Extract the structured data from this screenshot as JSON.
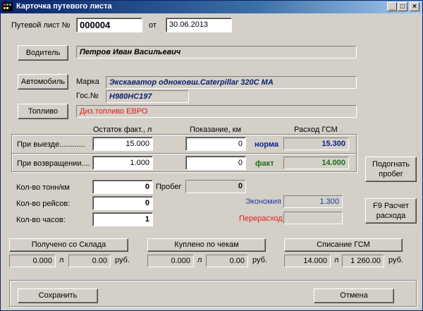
{
  "window": {
    "title": "Карточка путевого листа",
    "controls": [
      "_",
      "□",
      "×"
    ]
  },
  "header": {
    "waybill_label": "Путевой лист №",
    "waybill_number": "000004",
    "date_label": "от",
    "date_value": "30.06.2013"
  },
  "driver": {
    "button": "Водитель",
    "value": "Петров Иван Васильевич"
  },
  "vehicle": {
    "button": "Автомобиль",
    "model_label": "Марка",
    "model_value": "Экскаватор одноковш.Caterpillar 320C MA",
    "reg_label": "Гос.№",
    "reg_value": "Н980НС197"
  },
  "fuel": {
    "button": "Топливо",
    "value": "Диз.топливо ЕВРО"
  },
  "readings": {
    "col_remaining": "Остаток факт., л",
    "col_odometer": "Показание, км",
    "col_consumption": "Расход ГСМ",
    "departure_label": "При выезде............",
    "departure_remaining": "15.000",
    "departure_odometer": "0",
    "norm_label": "норма",
    "norm_value": "15.300",
    "return_label": "При возвращении....",
    "return_remaining": "1.000",
    "return_odometer": "0",
    "fact_label": "факт",
    "fact_value": "14.000"
  },
  "stats": {
    "tonkm_label": "Кол-во тонн/км",
    "tonkm_value": "0",
    "mileage_label": "Пробег",
    "mileage_value": "0",
    "trips_label": "Кол-во рейсов:",
    "trips_value": "0",
    "hours_label": "Кол-во часов:",
    "hours_value": "1",
    "economy_label": "Экономия",
    "economy_value": "1.300",
    "overrun_label": "Перерасход",
    "overrun_value": ""
  },
  "side_buttons": {
    "adjust_mileage": "Подогнать пробег",
    "calc_consumption": "F9 Расчет расхода"
  },
  "totals": {
    "received_button": "Получено со Склада",
    "received_liters": "0.000",
    "received_rub": "0.00",
    "bought_button": "Куплено по чекам",
    "bought_liters": "0.000",
    "bought_rub": "0.00",
    "writeoff_button": "Списание ГСМ",
    "writeoff_liters": "14.000",
    "writeoff_rub": "1 260.00",
    "unit_liters": "л",
    "unit_rub": "руб."
  },
  "footer": {
    "save": "Сохранить",
    "cancel": "Отмена"
  },
  "colors": {
    "titlebar": "#0a246a",
    "norm": "#0a1f8f",
    "fact": "#1a6e1a",
    "economy": "#1a3fa0",
    "overrun": "#e01b1b",
    "fuel_text": "#e01b1b",
    "driver_text": "#000000",
    "vehicle_text": "#0a1f6a"
  }
}
